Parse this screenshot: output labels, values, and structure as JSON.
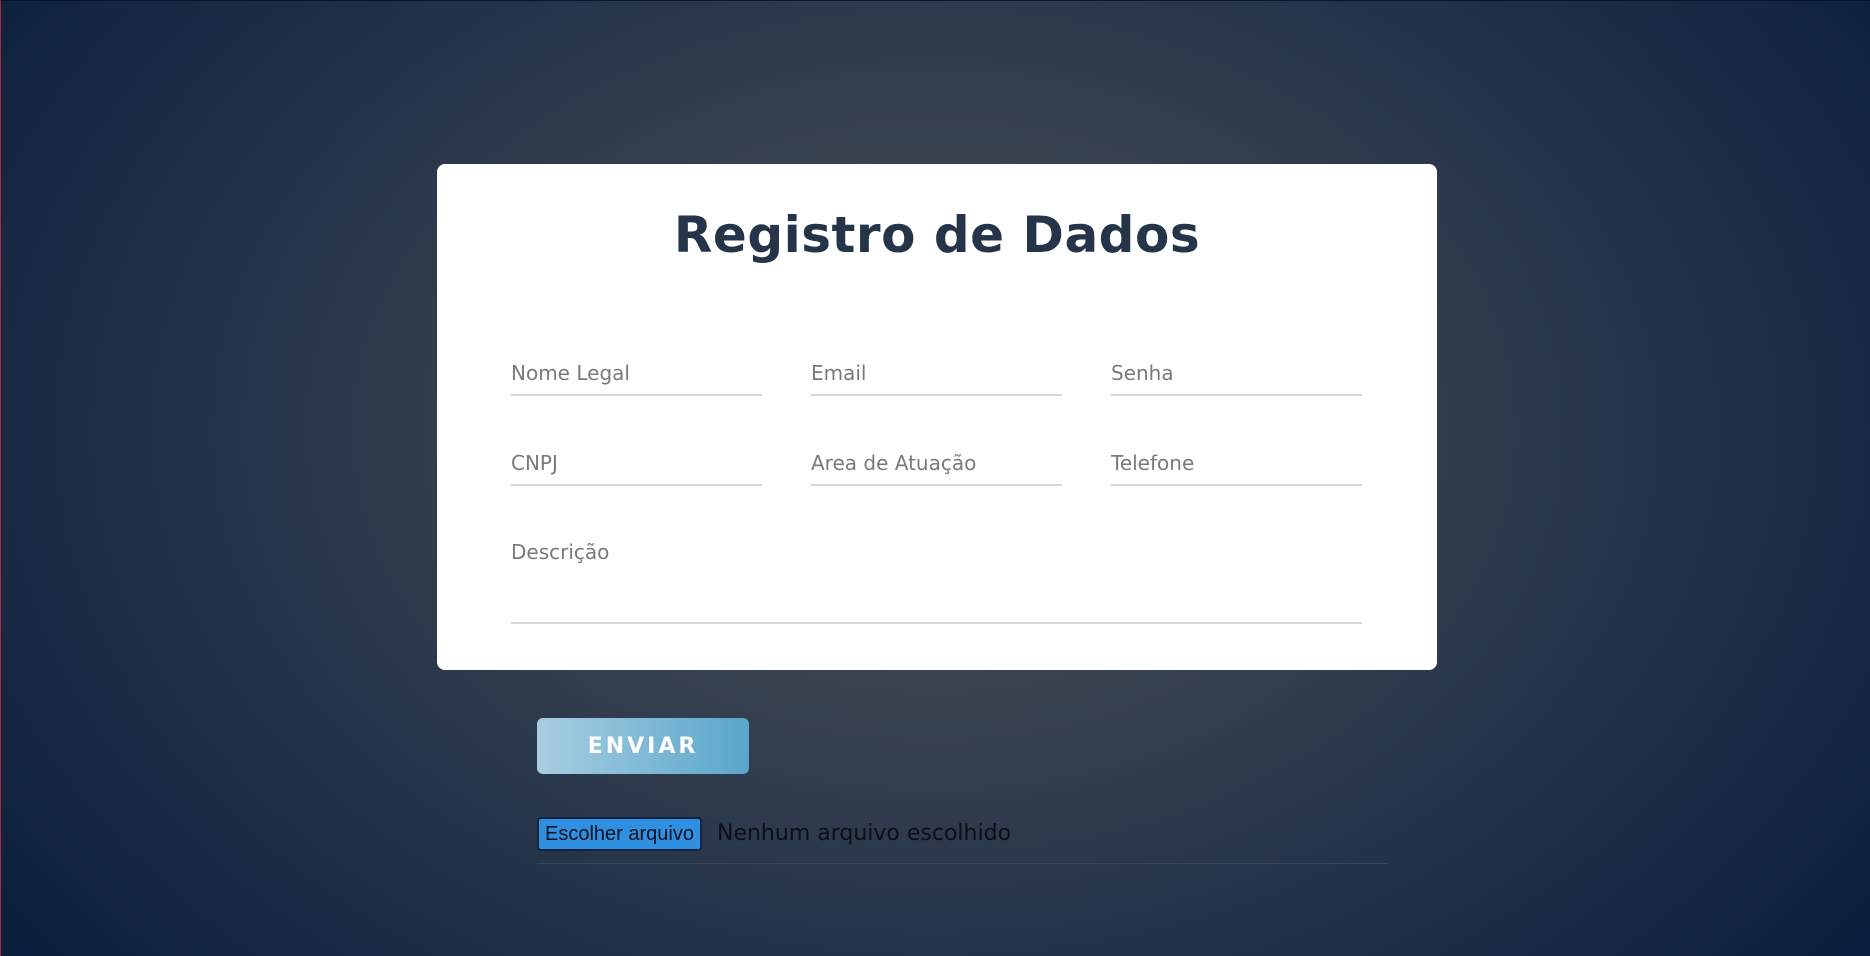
{
  "form": {
    "title": "Registro de Dados",
    "fields": {
      "nome_legal": {
        "placeholder": "Nome Legal",
        "value": ""
      },
      "email": {
        "placeholder": "Email",
        "value": ""
      },
      "senha": {
        "placeholder": "Senha",
        "value": ""
      },
      "cnpj": {
        "placeholder": "CNPJ",
        "value": ""
      },
      "area_atuacao": {
        "placeholder": "Area de Atuação",
        "value": ""
      },
      "telefone": {
        "placeholder": "Telefone",
        "value": ""
      },
      "descricao": {
        "placeholder": "Descrição",
        "value": ""
      }
    }
  },
  "actions": {
    "submit_label": "ENVIAR"
  },
  "file_upload": {
    "button_label": "Escolher arquivo",
    "status_text": "Nenhum arquivo escolhido"
  },
  "colors": {
    "title": "#26344a",
    "submit_gradient_start": "#a8cde0",
    "submit_gradient_end": "#5aa6cb",
    "file_button": "#2f8fe0",
    "background_dark": "#0b1f3e"
  }
}
